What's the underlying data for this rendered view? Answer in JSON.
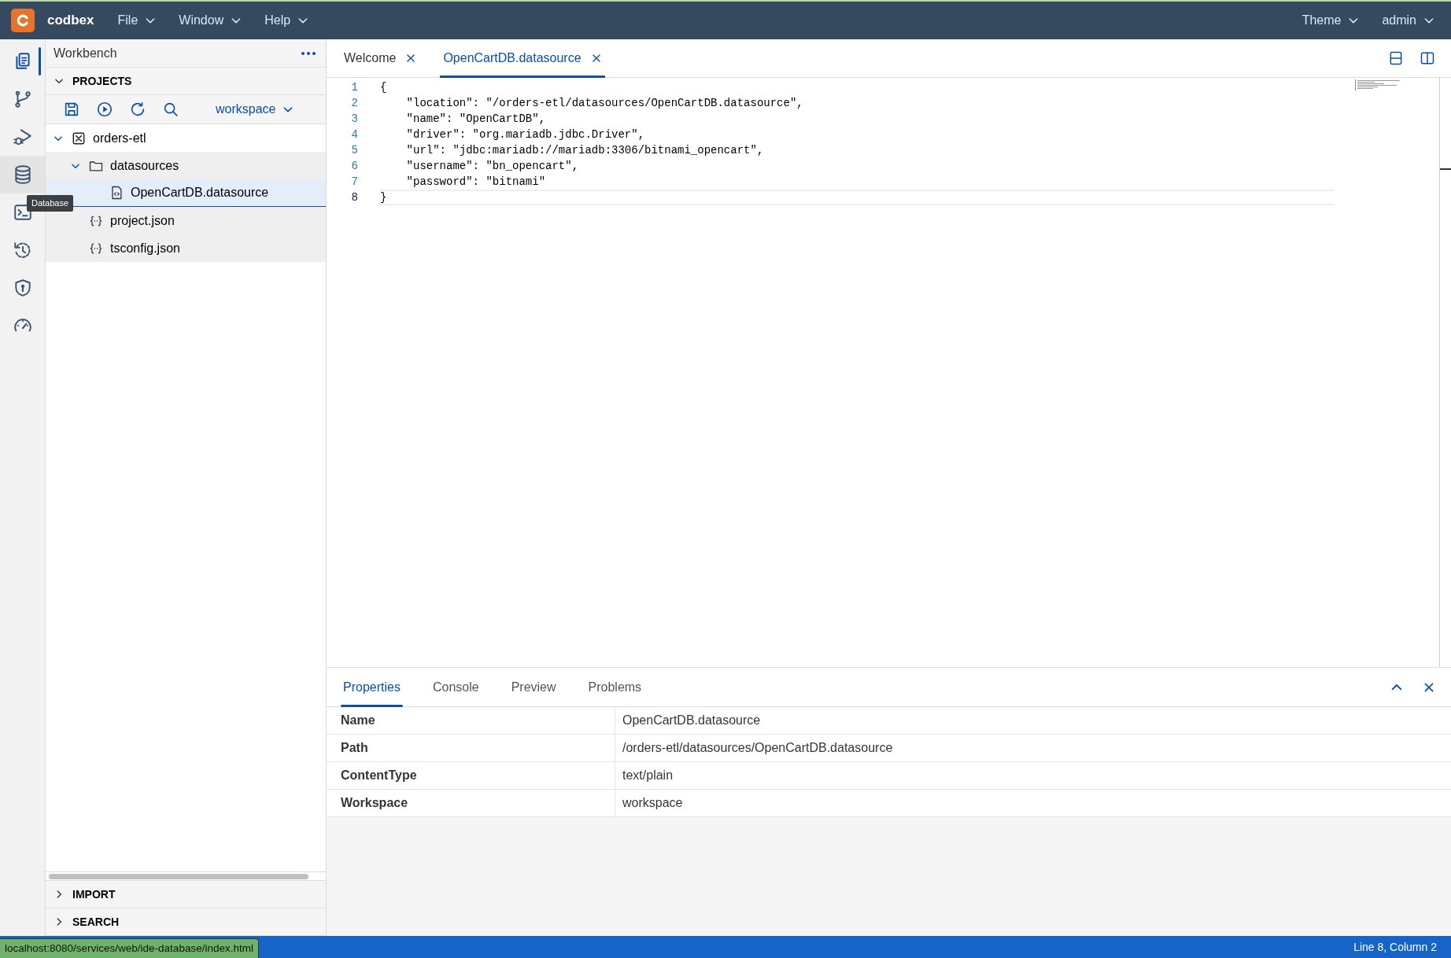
{
  "navbar": {
    "brand": "codbex",
    "menus": [
      "File",
      "Window",
      "Help"
    ],
    "right_menus": [
      "Theme",
      "admin"
    ]
  },
  "activity_bar": {
    "items": [
      {
        "kind": "files",
        "selected": true,
        "hovered": false
      },
      {
        "kind": "branch",
        "selected": false,
        "hovered": false
      },
      {
        "kind": "debug",
        "selected": false,
        "hovered": false
      },
      {
        "kind": "database",
        "selected": false,
        "hovered": true
      },
      {
        "kind": "terminal",
        "selected": false,
        "hovered": false
      },
      {
        "kind": "history",
        "selected": false,
        "hovered": false
      },
      {
        "kind": "shield",
        "selected": false,
        "hovered": false
      },
      {
        "kind": "gauge",
        "selected": false,
        "hovered": false
      }
    ],
    "tooltip": "Database"
  },
  "sidebar": {
    "title": "Workbench",
    "projects": {
      "label": "PROJECTS",
      "expanded": true
    },
    "workspace": "workspace",
    "tree": [
      {
        "label": "orders-etl",
        "kind": "project",
        "expanded": true,
        "selected": false,
        "children": [
          {
            "label": "datasources",
            "kind": "folder",
            "expanded": true,
            "selected": false,
            "children": [
              {
                "label": "OpenCartDB.datasource",
                "kind": "datasource",
                "selected": true
              }
            ]
          },
          {
            "label": "project.json",
            "kind": "json",
            "selected": false
          },
          {
            "label": "tsconfig.json",
            "kind": "json",
            "selected": false
          }
        ]
      }
    ],
    "sections": [
      {
        "label": "IMPORT",
        "expanded": false
      },
      {
        "label": "SEARCH",
        "expanded": false
      }
    ]
  },
  "editor": {
    "tabs": [
      {
        "label": "Welcome",
        "selected": false
      },
      {
        "label": "OpenCartDB.datasource",
        "selected": true
      }
    ],
    "lines": [
      {
        "number": "1",
        "text": "{",
        "current": false
      },
      {
        "number": "2",
        "text": "    \"location\": \"/orders-etl/datasources/OpenCartDB.datasource\",",
        "current": false
      },
      {
        "number": "3",
        "text": "    \"name\": \"OpenCartDB\",",
        "current": false
      },
      {
        "number": "4",
        "text": "    \"driver\": \"org.mariadb.jdbc.Driver\",",
        "current": false
      },
      {
        "number": "5",
        "text": "    \"url\": \"jdbc:mariadb://mariadb:3306/bitnami_opencart\",",
        "current": false
      },
      {
        "number": "6",
        "text": "    \"username\": \"bn_opencart\",",
        "current": false
      },
      {
        "number": "7",
        "text": "    \"password\": \"bitnami\"",
        "current": false
      },
      {
        "number": "8",
        "text": "}",
        "current": true
      }
    ]
  },
  "bottom_panel": {
    "tabs": [
      {
        "label": "Properties",
        "selected": true
      },
      {
        "label": "Console",
        "selected": false
      },
      {
        "label": "Preview",
        "selected": false
      },
      {
        "label": "Problems",
        "selected": false
      }
    ],
    "properties": [
      {
        "name": "Name",
        "value": "OpenCartDB.datasource"
      },
      {
        "name": "Path",
        "value": "/orders-etl/datasources/OpenCartDB.datasource"
      },
      {
        "name": "ContentType",
        "value": "text/plain"
      },
      {
        "name": "Workspace",
        "value": "workspace"
      }
    ]
  },
  "status_bar": {
    "link_hint": "localhost:8080/services/web/ide-database/index.html",
    "position": "Line 8, Column 2"
  }
}
